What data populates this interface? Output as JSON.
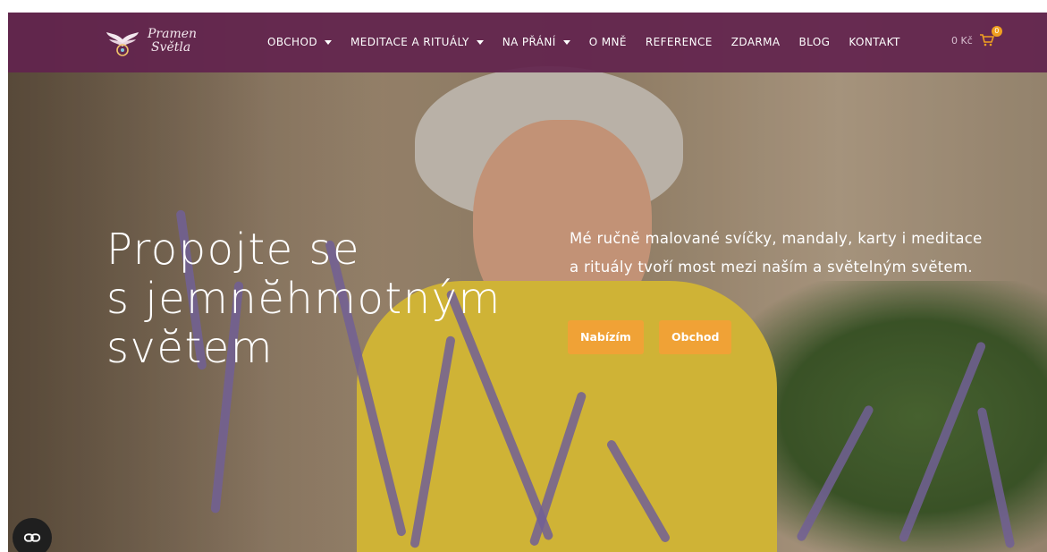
{
  "colors": {
    "nav_bg": "#62234e",
    "button_bg": "#f0a236",
    "badge_bg": "#f0a020",
    "text": "#ffffff"
  },
  "logo": {
    "line1": "Pramen",
    "line2": "Světla"
  },
  "menu": {
    "items": [
      {
        "label": "OBCHOD",
        "has_dropdown": true
      },
      {
        "label": "MEDITACE A RITUÁLY",
        "has_dropdown": true
      },
      {
        "label": "NA PŘÁNÍ",
        "has_dropdown": true
      },
      {
        "label": "O MNĚ",
        "has_dropdown": false
      },
      {
        "label": "REFERENCE",
        "has_dropdown": false
      },
      {
        "label": "ZDARMA",
        "has_dropdown": false
      },
      {
        "label": "BLOG",
        "has_dropdown": false
      },
      {
        "label": "KONTAKT",
        "has_dropdown": false
      }
    ]
  },
  "cart": {
    "total": "0 Kč",
    "count": "0",
    "icon": "cart-icon"
  },
  "hero": {
    "title_lines": [
      "Propojte se",
      "s jemnĕhmotným",
      "svĕtem"
    ],
    "subtitle_lines": [
      "Mé ručnĕ malované svíčky, mandaly, karty i meditace",
      "a rituály tvoří most mezi naším a svĕtelným svĕtem."
    ],
    "button_offer": "Nabízím",
    "button_shop": "Obchod"
  },
  "floating_button": {
    "icon": "link-icon"
  }
}
